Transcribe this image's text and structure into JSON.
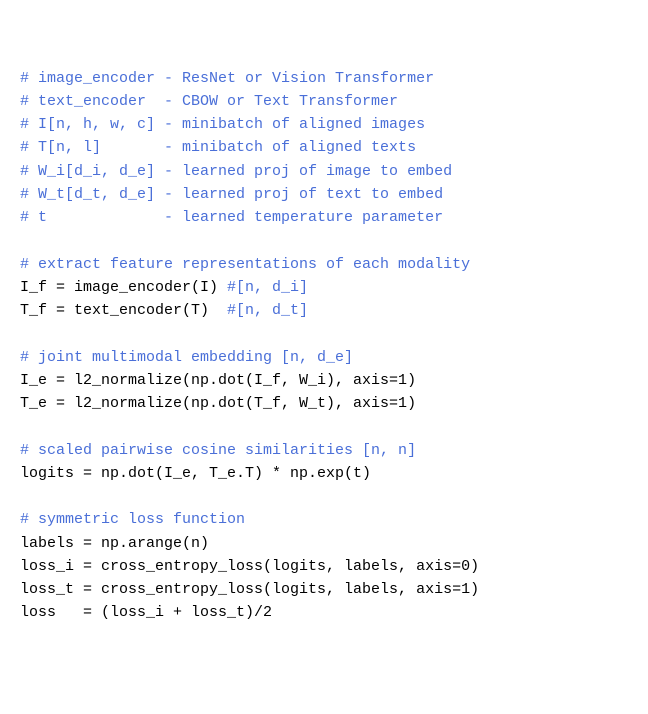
{
  "code_listing": {
    "lines": [
      {
        "type": "comment",
        "text": "# image_encoder - ResNet or Vision Transformer"
      },
      {
        "type": "comment",
        "text": "# text_encoder  - CBOW or Text Transformer"
      },
      {
        "type": "comment",
        "text": "# I[n, h, w, c] - minibatch of aligned images"
      },
      {
        "type": "comment",
        "text": "# T[n, l]       - minibatch of aligned texts"
      },
      {
        "type": "comment",
        "text": "# W_i[d_i, d_e] - learned proj of image to embed"
      },
      {
        "type": "comment",
        "text": "# W_t[d_t, d_e] - learned proj of text to embed"
      },
      {
        "type": "comment",
        "text": "# t             - learned temperature parameter"
      },
      {
        "type": "blank",
        "text": ""
      },
      {
        "type": "comment",
        "text": "# extract feature representations of each modality"
      },
      {
        "type": "mixed",
        "code": "I_f = image_encoder(I) ",
        "trail": "#[n, d_i]"
      },
      {
        "type": "mixed",
        "code": "T_f = text_encoder(T)  ",
        "trail": "#[n, d_t]"
      },
      {
        "type": "blank",
        "text": ""
      },
      {
        "type": "comment",
        "text": "# joint multimodal embedding [n, d_e]"
      },
      {
        "type": "code",
        "text": "I_e = l2_normalize(np.dot(I_f, W_i), axis=1)"
      },
      {
        "type": "code",
        "text": "T_e = l2_normalize(np.dot(T_f, W_t), axis=1)"
      },
      {
        "type": "blank",
        "text": ""
      },
      {
        "type": "comment",
        "text": "# scaled pairwise cosine similarities [n, n]"
      },
      {
        "type": "code",
        "text": "logits = np.dot(I_e, T_e.T) * np.exp(t)"
      },
      {
        "type": "blank",
        "text": ""
      },
      {
        "type": "comment",
        "text": "# symmetric loss function"
      },
      {
        "type": "code",
        "text": "labels = np.arange(n)"
      },
      {
        "type": "code",
        "text": "loss_i = cross_entropy_loss(logits, labels, axis=0)"
      },
      {
        "type": "code",
        "text": "loss_t = cross_entropy_loss(logits, labels, axis=1)"
      },
      {
        "type": "code",
        "text": "loss   = (loss_i + loss_t)/2"
      }
    ]
  }
}
